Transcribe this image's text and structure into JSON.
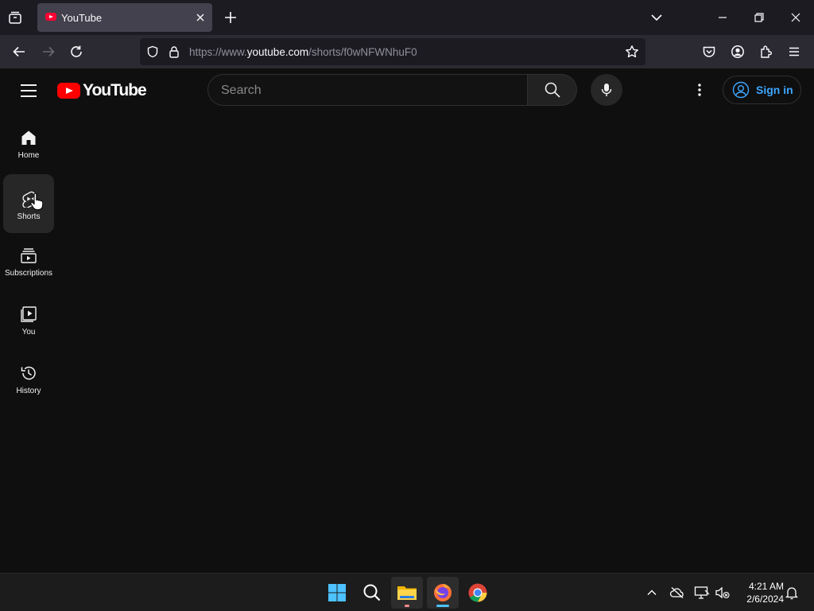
{
  "browser": {
    "tab": {
      "title": "YouTube"
    },
    "url": {
      "prefix": "https://www.",
      "host": "youtube.com",
      "path": "/shorts/f0wNFWNhuF0"
    }
  },
  "youtube": {
    "logo_text": "YouTube",
    "search": {
      "placeholder": "Search"
    },
    "signin_label": "Sign in",
    "accent": "#ff0000",
    "sidebar": {
      "items": [
        {
          "label": "Home",
          "icon": "home-icon"
        },
        {
          "label": "Shorts",
          "icon": "shorts-icon",
          "active": true
        },
        {
          "label": "Subscriptions",
          "icon": "subscriptions-icon"
        },
        {
          "label": "You",
          "icon": "you-icon"
        },
        {
          "label": "History",
          "icon": "history-icon"
        }
      ]
    }
  },
  "taskbar": {
    "apps": [
      "start-icon",
      "search-icon",
      "file-explorer-icon",
      "firefox-icon",
      "chrome-icon"
    ],
    "clock": {
      "time": "4:21 AM",
      "date": "2/6/2024"
    }
  }
}
